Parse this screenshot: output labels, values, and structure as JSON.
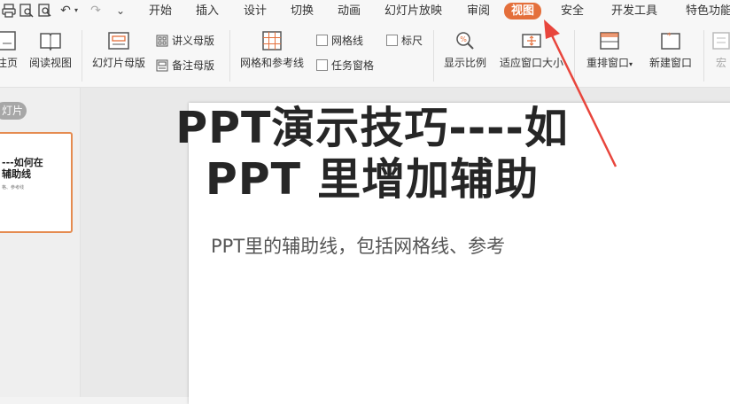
{
  "menu": {
    "tabs": [
      "开始",
      "插入",
      "设计",
      "切换",
      "动画",
      "幻灯片放映",
      "审阅",
      "视图",
      "安全",
      "开发工具",
      "特色功能"
    ],
    "active_tab": "视图"
  },
  "ribbon": {
    "page_view": "注页",
    "reading_view": "阅读视图",
    "slide_master": "幻灯片母版",
    "handout_master": "讲义母版",
    "notes_master": "备注母版",
    "grid_guides": "网格和参考线",
    "gridlines": "网格线",
    "ruler": "标尺",
    "task_pane": "任务窗格",
    "zoom": "显示比例",
    "fit_window": "适应窗口大小",
    "rearrange_windows": "重排窗口",
    "new_window": "新建窗口",
    "macro": "宏"
  },
  "left_panel": {
    "tab_label": "灯片",
    "thumb_title": "---如何在\n辅助线",
    "thumb_sub": "格、参考线"
  },
  "slide": {
    "title_line1": "PPT演示技巧----如",
    "title_line2": "PPT 里增加辅助",
    "subtitle": "PPT里的辅助线，包括网格线、参考"
  },
  "colors": {
    "accent": "#e46f3b",
    "arrow": "#e8453c"
  }
}
